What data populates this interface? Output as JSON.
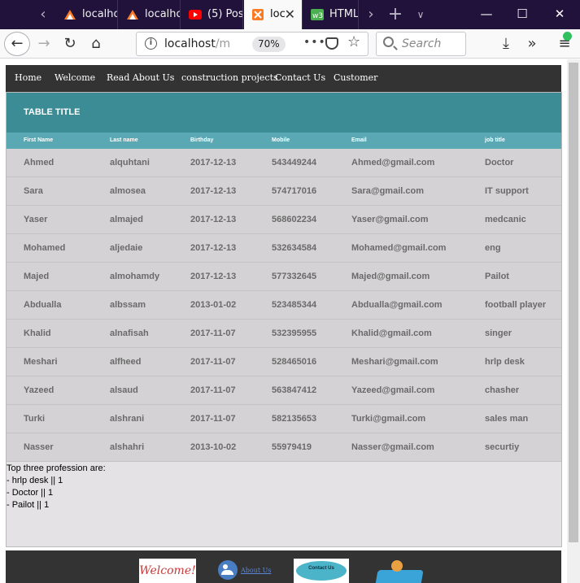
{
  "browser": {
    "tabs": [
      {
        "label": "localhost",
        "icon": "xampp-icon",
        "active": false
      },
      {
        "label": "localho",
        "icon": "xampp-icon",
        "active": false
      },
      {
        "label": "(5) Pos",
        "icon": "youtube-icon",
        "active": false
      },
      {
        "label": "loc",
        "icon": "xampp-icon",
        "active": true
      },
      {
        "label": "HTML",
        "icon": "w3schools-icon",
        "active": false
      }
    ],
    "url_main": "localhost",
    "url_dim": "/m",
    "zoom": "70%",
    "search_placeholder": "Search",
    "more_label": "•••"
  },
  "site_nav": [
    "Home",
    "Welcome",
    "Read About Us",
    "construction projects",
    "Contact Us",
    "Customer"
  ],
  "table": {
    "title": "TABLE TITLE",
    "columns": [
      "First Name",
      "Last name",
      "Birthday",
      "Mobile",
      "Email",
      "job title"
    ],
    "rows": [
      [
        "Ahmed",
        "alquhtani",
        "2017-12-13",
        "543449244",
        "Ahmed@gmail.com",
        "Doctor"
      ],
      [
        "Sara",
        "almosea",
        "2017-12-13",
        "574717016",
        "Sara@gmail.com",
        "IT support"
      ],
      [
        "Yaser",
        "almajed",
        "2017-12-13",
        "568602234",
        "Yaser@gmail.com",
        "medcanic"
      ],
      [
        "Mohamed",
        "aljedaie",
        "2017-12-13",
        "532634584",
        "Mohamed@gmail.com",
        "eng"
      ],
      [
        "Majed",
        "almohamdy",
        "2017-12-13",
        "577332645",
        "Majed@gmail.com",
        "Pailot"
      ],
      [
        "Abdualla",
        "albssam",
        "2013-01-02",
        "523485344",
        "Abdualla@gmail.com",
        "football player"
      ],
      [
        "Khalid",
        "alnafisah",
        "2017-11-07",
        "532395955",
        "Khalid@gmail.com",
        "singer"
      ],
      [
        "Meshari",
        "alfheed",
        "2017-11-07",
        "528465016",
        "Meshari@gmail.com",
        "hrlp desk"
      ],
      [
        "Yazeed",
        "alsaud",
        "2017-11-07",
        "563847412",
        "Yazeed@gmail.com",
        "chasher"
      ],
      [
        "Turki",
        "alshrani",
        "2017-11-07",
        "582135653",
        "Turki@gmail.com",
        "sales man"
      ],
      [
        "Nasser",
        "alshahri",
        "2013-10-02",
        "55979419",
        "Nasser@gmail.com",
        "securtiy"
      ]
    ]
  },
  "summary": {
    "heading": "Top three profession are:",
    "items": [
      "- hrlp desk || 1",
      "- Doctor || 1",
      "- Pailot || 1"
    ]
  },
  "footer": {
    "welcome_text": "Welcome!",
    "about_label": "About Us",
    "contact_text": "Contact Us"
  }
}
